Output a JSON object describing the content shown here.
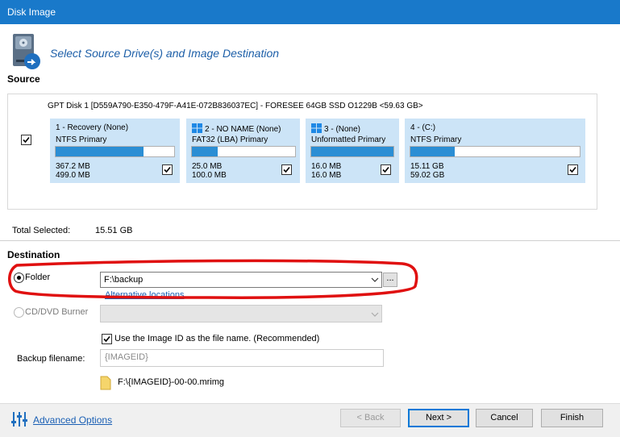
{
  "window": {
    "title": "Disk Image"
  },
  "header": {
    "text": "Select Source Drive(s) and Image Destination"
  },
  "source": {
    "label": "Source",
    "disk_title": "GPT Disk 1 [D559A790-E350-479F-A41E-072B836037EC] - FORESEE 64GB SSD O1229B  <59.63 GB>",
    "partitions": [
      {
        "title": "1 - Recovery (None)",
        "type": "NTFS Primary",
        "used": "367.2 MB",
        "total": "499.0 MB",
        "fill": 0.74,
        "windows_logo": false
      },
      {
        "title": "2 - NO NAME (None)",
        "type": "FAT32 (LBA) Primary",
        "used": "25.0 MB",
        "total": "100.0 MB",
        "fill": 0.25,
        "windows_logo": true
      },
      {
        "title": "3 -  (None)",
        "type": "Unformatted Primary",
        "used": "16.0 MB",
        "total": "16.0 MB",
        "fill": 1.0,
        "windows_logo": true
      },
      {
        "title": "4 -  (C:)",
        "type": "NTFS Primary",
        "used": "15.11 GB",
        "total": "59.02 GB",
        "fill": 0.26,
        "windows_logo": false
      }
    ],
    "total_label": "Total Selected:",
    "total_value": "15.51 GB"
  },
  "destination": {
    "label": "Destination",
    "folder_label": "Folder",
    "folder_value": "F:\\backup",
    "browse_label": "...",
    "alt_link": "Alternative locations",
    "cd_label": "CD/DVD Burner",
    "imageid_label": "Use the Image ID as the file name.  (Recommended)",
    "backup_label": "Backup filename:",
    "backup_placeholder": "{IMAGEID}",
    "path": "F:\\{IMAGEID}-00-00.mrimg"
  },
  "footer": {
    "advanced_label": "Advanced Options",
    "back_label": "< Back",
    "next_label": "Next >",
    "cancel_label": "Cancel",
    "finish_label": "Finish"
  },
  "colors": {
    "accent": "#1979ca",
    "bar_fill": "#2b8ed4",
    "partition_bg": "#cce4f7",
    "highlight_oval": "#e01010"
  }
}
